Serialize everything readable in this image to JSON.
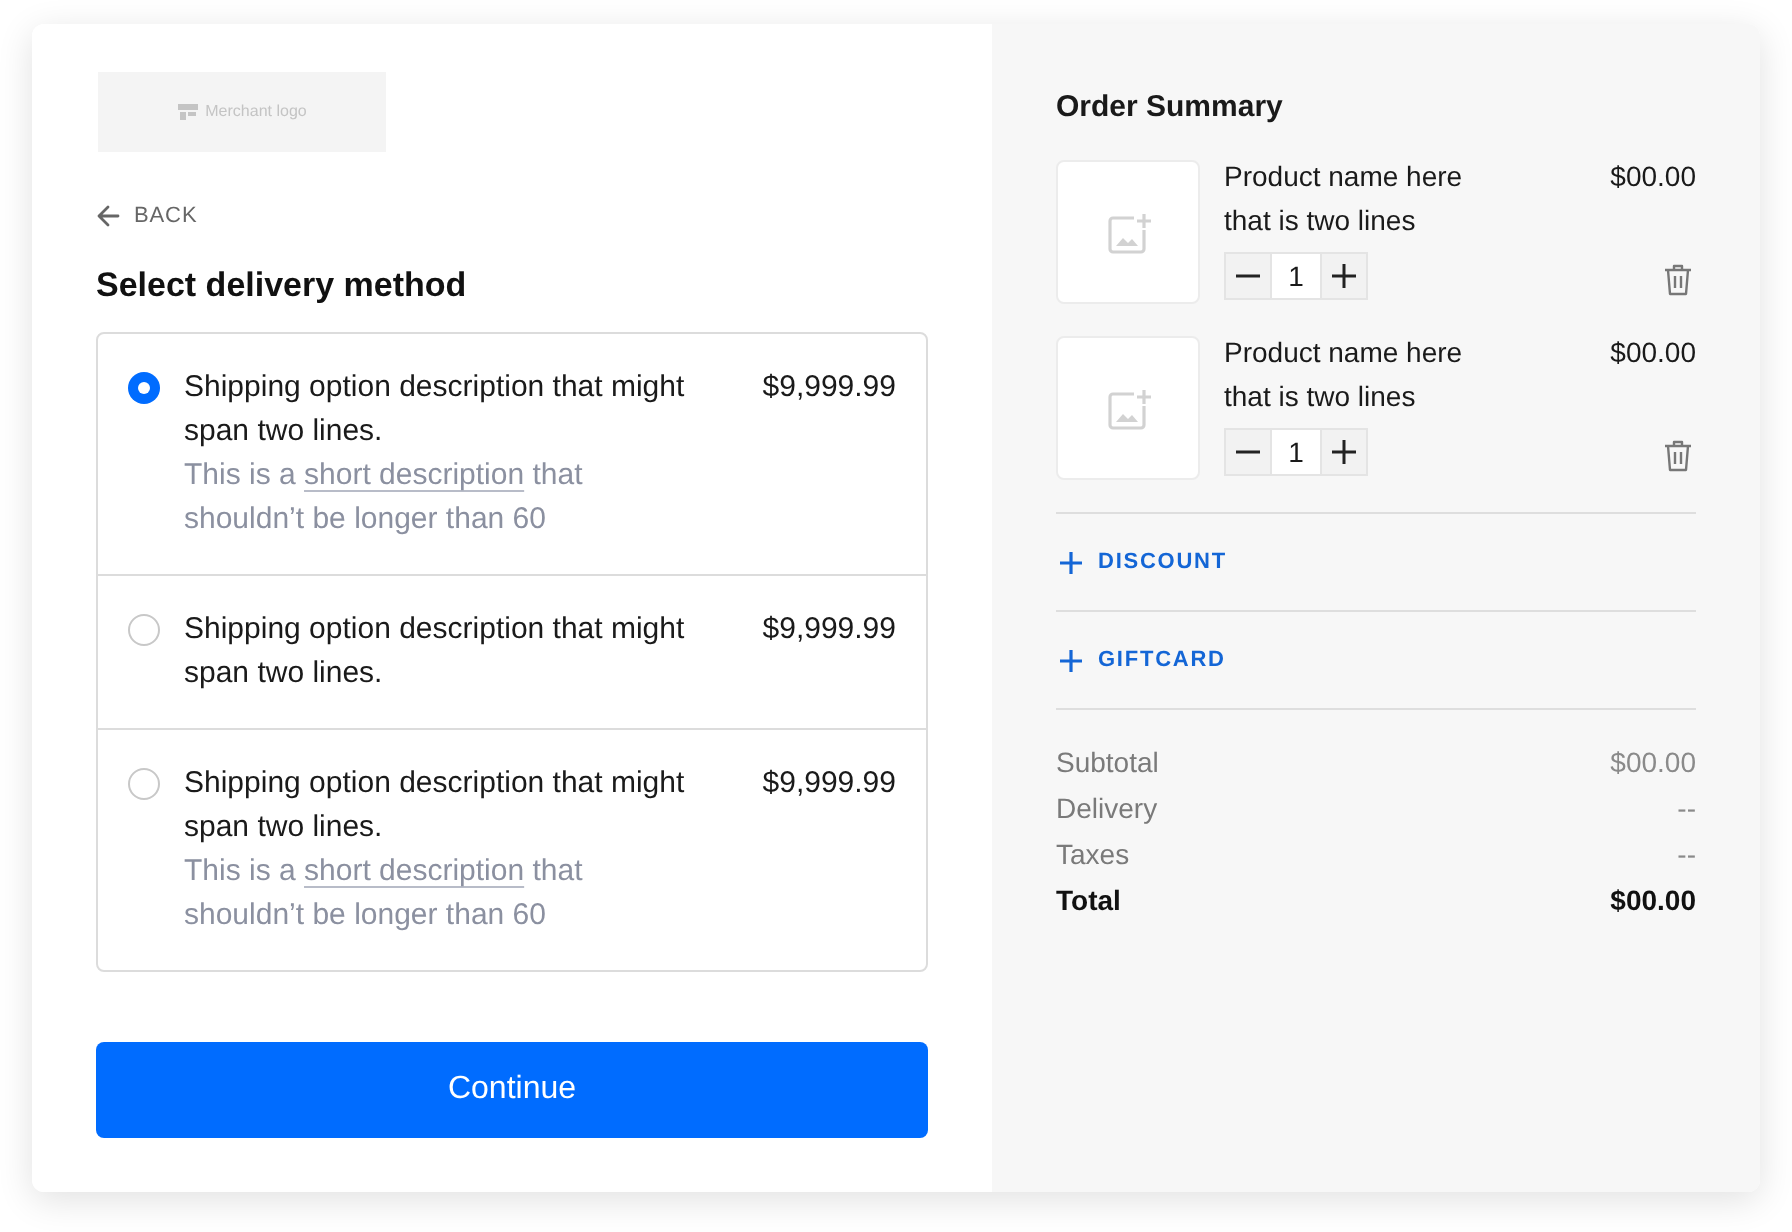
{
  "merchant_logo": {
    "label": "Merchant logo"
  },
  "back_link": {
    "label": "BACK"
  },
  "heading": "Select delivery method",
  "shipping_options": [
    {
      "title": "Shipping option description that might span two lines.",
      "price": "$9,999.99",
      "selected": true,
      "description": {
        "before": "This is a ",
        "link": "short description",
        "after": " that shouldn’t be longer than 60"
      }
    },
    {
      "title": "Shipping option description that might span two lines.",
      "price": "$9,999.99",
      "selected": false
    },
    {
      "title": "Shipping option description that might span two lines.",
      "price": "$9,999.99",
      "selected": false,
      "description": {
        "before": "This is a ",
        "link": "short description",
        "after": " that shouldn’t be longer than 60"
      }
    }
  ],
  "continue_button": {
    "label": "Continue"
  },
  "order_summary": {
    "title": "Order Summary",
    "products": [
      {
        "name": "Product name here that is two lines",
        "price": "$00.00",
        "quantity": "1"
      },
      {
        "name": "Product name here that is two lines",
        "price": "$00.00",
        "quantity": "1"
      }
    ],
    "actions": [
      {
        "label": "DISCOUNT"
      },
      {
        "label": "GIFTCARD"
      }
    ],
    "totals": [
      {
        "label": "Subtotal",
        "value": "$00.00",
        "kind": "line"
      },
      {
        "label": "Delivery",
        "value": "--",
        "kind": "line"
      },
      {
        "label": "Taxes",
        "value": "--",
        "kind": "line"
      },
      {
        "label": "Total",
        "value": "$00.00",
        "kind": "total"
      }
    ]
  }
}
